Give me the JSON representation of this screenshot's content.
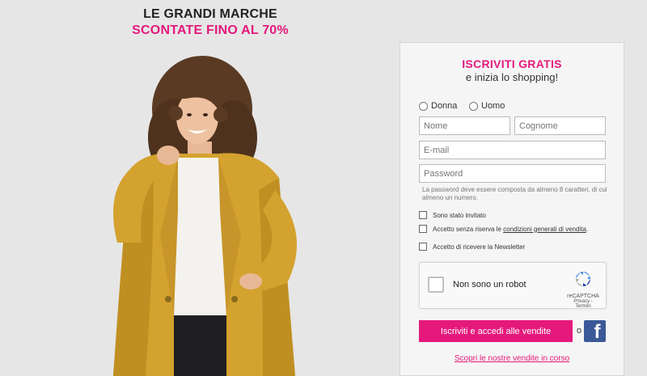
{
  "headline": {
    "line1": "LE GRANDI MARCHE",
    "line2": "SCONTATE FINO AL 70%"
  },
  "colors": {
    "accent": "#e5197c",
    "facebook": "#3b5998",
    "background": "#e6e6e6"
  },
  "form": {
    "title": "ISCRIVITI GRATIS",
    "subtitle": "e inizia lo shopping!",
    "gender_options": [
      "Donna",
      "Uomo"
    ],
    "placeholders": {
      "first_name": "Nome",
      "last_name": "Cognome",
      "email": "E-mail",
      "password": "Password"
    },
    "password_hint": "La password deve essere composta da almeno 8 caratteri, di cui almeno un numero.",
    "checkbox_invited": "Sono stato invitato",
    "checkbox_terms_prefix": "Accetto senza riserva le ",
    "checkbox_terms_link": "condizioni generali di vendita",
    "checkbox_terms_suffix": ".",
    "checkbox_newsletter": "Accetto di ricevere la Newsletter",
    "captcha": {
      "label": "Non sono un robot",
      "brand": "reCAPTCHA",
      "terms": "Privacy - Termini"
    },
    "submit_label": "Iscriviti e accedi alle vendite",
    "or_label": "o",
    "facebook_icon": "f",
    "discover_link": "Scopri le nostre vendite in corso"
  }
}
